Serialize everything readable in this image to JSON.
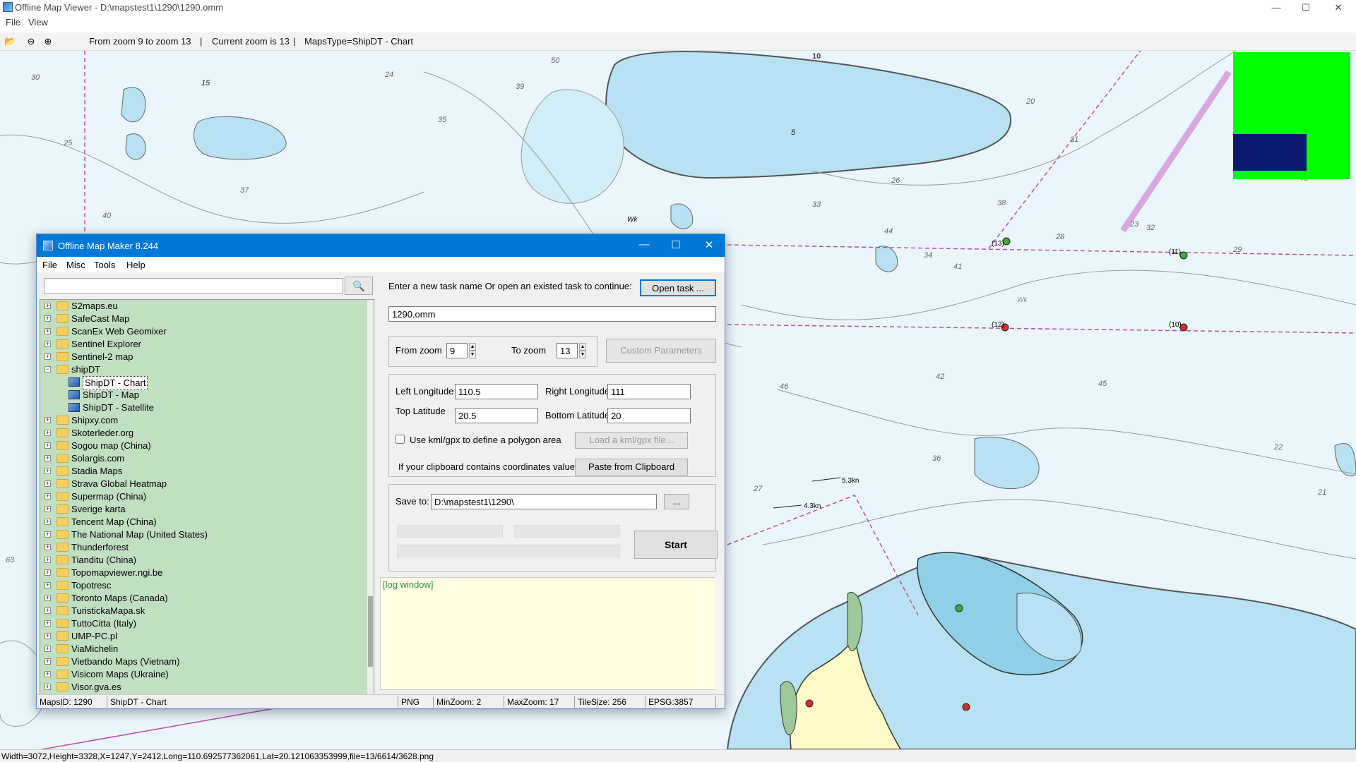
{
  "app": {
    "title": "Offline Map Viewer - D:\\mapstest1\\1290\\1290.omm",
    "menu": [
      "File",
      "View"
    ],
    "window_controls": {
      "minimize": "—",
      "maximize": "☐",
      "close": "✕"
    }
  },
  "toolbar": {
    "zoom_range": "From zoom 9 to zoom 13",
    "current_zoom": "Current zoom is 13",
    "maps_type": "MapsType=ShipDT - Chart",
    "sep": "|"
  },
  "statusbar": {
    "text": "Width=3072,Height=3328,X=1247,Y=2412,Long=110.692577362061,Lat=20.121063353999,file=13/6614/3628.png"
  },
  "map": {
    "depth_labels": [
      "30",
      "50",
      "10",
      "20",
      "15",
      "39",
      "24",
      "35",
      "5",
      "40",
      "25",
      "63",
      "33",
      "34",
      "41",
      "44",
      "46",
      "42",
      "45",
      "27",
      "31",
      "38",
      "32",
      "26",
      "36",
      "37",
      "43",
      "28",
      "29",
      "23",
      "21",
      "22"
    ],
    "markers": [
      "(13)",
      "(12)",
      "(11)",
      "(10)",
      "5.3kn",
      "4.3kn",
      "Wk"
    ],
    "minimap_colors": {
      "bg": "#00ff00",
      "viewport": "#0a1a6e"
    }
  },
  "dialog": {
    "title": "Offline Map Maker 8.244",
    "menu": [
      "File",
      "Misc",
      "Tools",
      "Help"
    ],
    "search_placeholder": "",
    "tree": [
      {
        "label": "S2maps.eu",
        "expanded": false
      },
      {
        "label": "SafeCast Map",
        "expanded": false
      },
      {
        "label": "ScanEx Web Geomixer",
        "expanded": false
      },
      {
        "label": "Sentinel Explorer",
        "expanded": false
      },
      {
        "label": "Sentinel-2 map",
        "expanded": false
      },
      {
        "label": "shipDT",
        "expanded": true
      },
      {
        "label": "ShipDT - Chart",
        "child": true,
        "selected": true
      },
      {
        "label": "ShipDT - Map",
        "child": true
      },
      {
        "label": "ShipDT - Satellite",
        "child": true
      },
      {
        "label": "Shipxy.com",
        "expanded": false
      },
      {
        "label": "Skoterleder.org",
        "expanded": false
      },
      {
        "label": "Sogou map (China)",
        "expanded": false
      },
      {
        "label": "Solargis.com",
        "expanded": false
      },
      {
        "label": "Stadia Maps",
        "expanded": false
      },
      {
        "label": "Strava Global Heatmap",
        "expanded": false
      },
      {
        "label": "Supermap (China)",
        "expanded": false
      },
      {
        "label": "Sverige karta",
        "expanded": false
      },
      {
        "label": "Tencent Map (China)",
        "expanded": false
      },
      {
        "label": "The National Map (United States)",
        "expanded": false
      },
      {
        "label": "Thunderforest",
        "expanded": false
      },
      {
        "label": "Tianditu (China)",
        "expanded": false
      },
      {
        "label": "Topomapviewer.ngi.be",
        "expanded": false
      },
      {
        "label": "Topotresc",
        "expanded": false
      },
      {
        "label": "Toronto Maps (Canada)",
        "expanded": false
      },
      {
        "label": "TuristickaMapa.sk",
        "expanded": false
      },
      {
        "label": "TuttoCitta (Italy)",
        "expanded": false
      },
      {
        "label": "UMP-PC.pl",
        "expanded": false
      },
      {
        "label": "ViaMichelin",
        "expanded": false
      },
      {
        "label": "Vietbando Maps (Vietnam)",
        "expanded": false
      },
      {
        "label": "Visicom Maps (Ukraine)",
        "expanded": false
      },
      {
        "label": "Visor.gva.es",
        "expanded": false
      }
    ],
    "task_prompt": "Enter a new task name Or open an existed task to continue:",
    "open_task": "Open task ...",
    "task_name": "1290.omm",
    "from_zoom_label": "From zoom",
    "from_zoom": "9",
    "to_zoom_label": "To zoom",
    "to_zoom": "13",
    "custom_params": "Custom Parameters",
    "left_lon_label": "Left Longitude",
    "left_lon": "110.5",
    "right_lon_label": "Right Longitude",
    "right_lon": "111",
    "top_lat_label": "Top Latitude",
    "top_lat": "20.5",
    "bottom_lat_label": "Bottom Latitude",
    "bottom_lat": "20",
    "kml_check": "Use kml/gpx to define a polygon area",
    "load_kml": "Load a kml/gpx file...",
    "clipboard_prompt": "If your clipboard contains coordinates values:",
    "paste": "Paste from Clipboard",
    "save_label": "Save to:",
    "save_path": "D:\\mapstest1\\1290\\",
    "browse": "...",
    "start": "Start",
    "log": "[log window]",
    "status": {
      "maps_id": "MapsID: 1290",
      "maps_name": "ShipDT - Chart",
      "format": "PNG",
      "min_zoom": "MinZoom: 2",
      "max_zoom": "MaxZoom: 17",
      "tile_size": "TileSize: 256",
      "epsg": "EPSG:3857"
    }
  }
}
